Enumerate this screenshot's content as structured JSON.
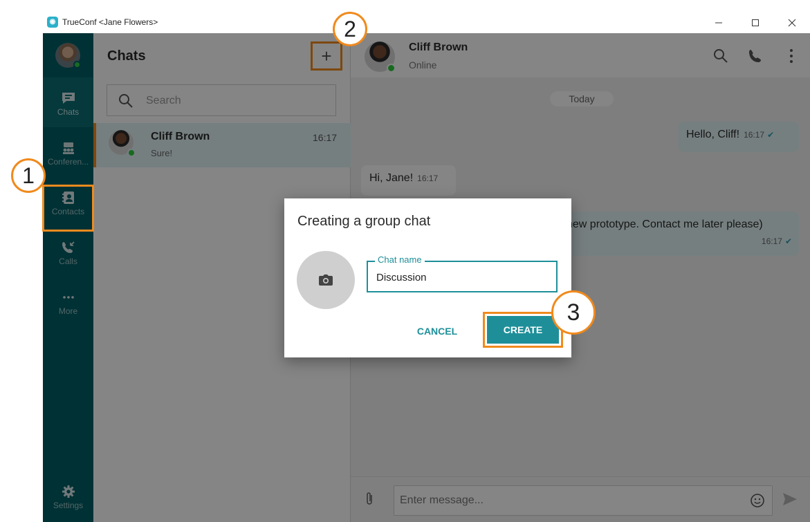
{
  "window": {
    "title": "TrueConf <Jane Flowers>"
  },
  "rail": {
    "items": [
      {
        "label": "Chats",
        "icon": "chat-icon"
      },
      {
        "label": "Conferen...",
        "icon": "conference-icon"
      },
      {
        "label": "Contacts",
        "icon": "contacts-icon"
      },
      {
        "label": "Calls",
        "icon": "calls-icon"
      },
      {
        "label": "More",
        "icon": "more-icon"
      }
    ],
    "settings_label": "Settings"
  },
  "chats": {
    "title": "Chats",
    "add_label": "+",
    "search_placeholder": "Search",
    "list": [
      {
        "name": "Cliff Brown",
        "preview": "Sure!",
        "time": "16:17"
      }
    ]
  },
  "conversation": {
    "name": "Cliff Brown",
    "status": "Online",
    "date_separator": "Today",
    "messages": [
      {
        "text": "Hello, Cliff!",
        "time": "16:17",
        "direction": "out"
      },
      {
        "text": "Hi, Jane!",
        "time": "16:17",
        "direction": "in"
      },
      {
        "text": "new prototype. Contact me later please)",
        "time": "16:17",
        "direction": "out"
      }
    ],
    "composer_placeholder": "Enter message..."
  },
  "dialog": {
    "title": "Creating a group chat",
    "field_label": "Chat name",
    "field_value": "Discussion",
    "cancel_label": "CANCEL",
    "create_label": "CREATE"
  },
  "steps": [
    "1",
    "2",
    "3"
  ],
  "colors": {
    "accent": "#1e8f99",
    "highlight": "#f08a1d",
    "rail": "#005f66"
  }
}
